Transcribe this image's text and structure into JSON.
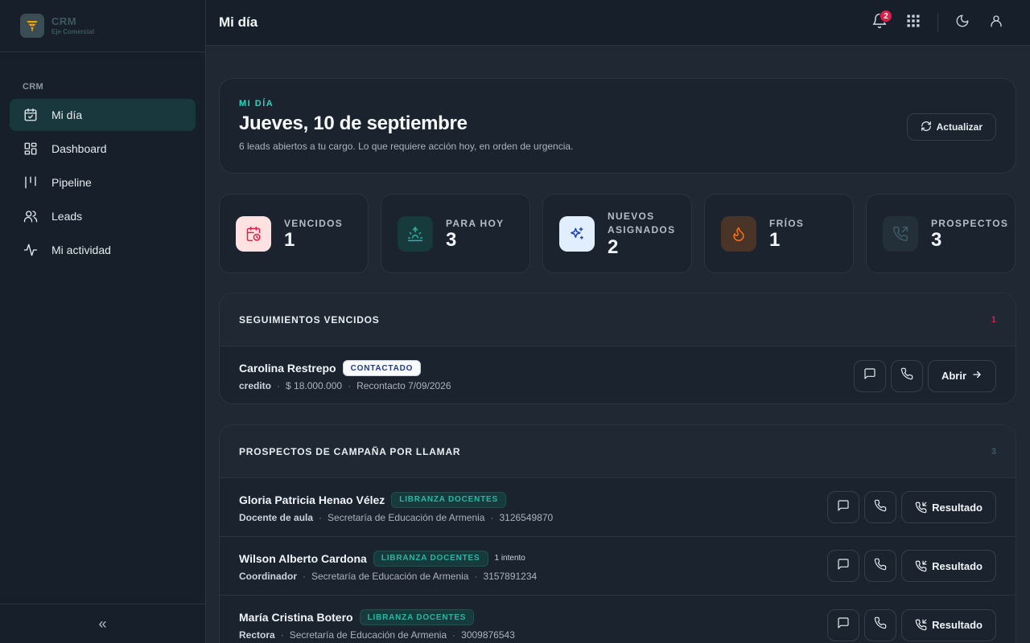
{
  "brand": {
    "title": "CRM",
    "subtitle": "Eje Comercial"
  },
  "sidebar": {
    "section": "CRM",
    "items": [
      {
        "label": "Mi día",
        "icon": "calendar-check-icon",
        "active": true
      },
      {
        "label": "Dashboard",
        "icon": "dashboard-icon"
      },
      {
        "label": "Pipeline",
        "icon": "pipeline-icon"
      },
      {
        "label": "Leads",
        "icon": "users-icon"
      },
      {
        "label": "Mi actividad",
        "icon": "activity-icon"
      }
    ],
    "collapse_label": "«"
  },
  "header": {
    "title": "Mi día",
    "notification_count": "2"
  },
  "hero": {
    "eyebrow": "MI DÍA",
    "title": "Jueves, 10 de septiembre",
    "subtitle": "6 leads abiertos a tu cargo. Lo que requiere acción hoy, en orden de urgencia.",
    "refresh_label": "Actualizar"
  },
  "stats": [
    {
      "label": "VENCIDOS",
      "value": "1",
      "icon": "calendar-clock-icon"
    },
    {
      "label": "PARA HOY",
      "value": "3",
      "icon": "sunrise-icon"
    },
    {
      "label": "NUEVOS ASIGNADOS",
      "value": "2",
      "icon": "sparkles-icon"
    },
    {
      "label": "FRÍOS",
      "value": "1",
      "icon": "flame-icon"
    },
    {
      "label": "PROSPECTOS",
      "value": "3",
      "icon": "phone-outgoing-icon"
    }
  ],
  "overdue": {
    "title": "SEGUIMIENTOS VENCIDOS",
    "count": "1",
    "rows": [
      {
        "name": "Carolina Restrepo",
        "tag": "CONTACTADO",
        "meta": [
          "credito",
          "$ 18.000.000",
          "Recontacto 7/09/2026"
        ],
        "action": "Abrir"
      }
    ]
  },
  "prospects": {
    "title": "PROSPECTOS DE CAMPAÑA POR LLAMAR",
    "count": "3",
    "action": "Resultado",
    "rows": [
      {
        "name": "Gloria Patricia Henao Vélez",
        "tag": "LIBRANZA DOCENTES",
        "attempts": "",
        "meta": [
          "Docente de aula",
          "Secretaría de Educación de Armenia",
          "3126549870"
        ]
      },
      {
        "name": "Wilson Alberto Cardona",
        "tag": "LIBRANZA DOCENTES",
        "attempts": "1 intento",
        "meta": [
          "Coordinador",
          "Secretaría de Educación de Armenia",
          "3157891234"
        ]
      },
      {
        "name": "María Cristina Botero",
        "tag": "LIBRANZA DOCENTES",
        "attempts": "",
        "meta": [
          "Rectora",
          "Secretaría de Educación de Armenia",
          "3009876543"
        ]
      }
    ]
  },
  "colors": {
    "accent": "#2dd4bf",
    "danger": "#e11d48",
    "sidebar_active": "#19383d"
  }
}
